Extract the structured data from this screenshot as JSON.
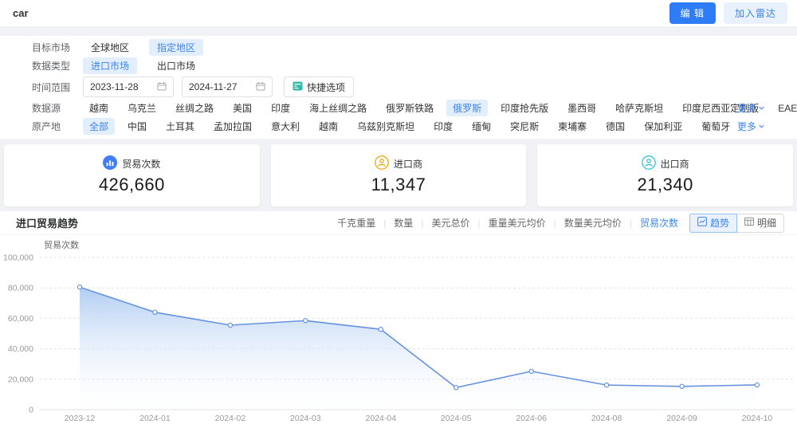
{
  "header": {
    "title": "car",
    "edit_button": "编 辑",
    "radar_button": "加入雷达"
  },
  "filters": {
    "target_market": {
      "label": "目标市场",
      "options": [
        {
          "label": "全球地区",
          "selected": false
        },
        {
          "label": "指定地区",
          "selected": true
        }
      ]
    },
    "data_type": {
      "label": "数据类型",
      "options": [
        {
          "label": "进口市场",
          "selected": true
        },
        {
          "label": "出口市场",
          "selected": false
        }
      ]
    },
    "time_range": {
      "label": "时间范围",
      "start": "2023-11-28",
      "end": "2024-11-27",
      "quick_button": "快捷选项"
    },
    "data_source": {
      "label": "数据源",
      "more": "更多",
      "options": [
        {
          "label": "越南",
          "selected": false
        },
        {
          "label": "乌克兰",
          "selected": false
        },
        {
          "label": "丝绸之路",
          "selected": false
        },
        {
          "label": "美国",
          "selected": false
        },
        {
          "label": "印度",
          "selected": false
        },
        {
          "label": "海上丝绸之路",
          "selected": false
        },
        {
          "label": "俄罗斯铁路",
          "selected": false
        },
        {
          "label": "俄罗斯",
          "selected": true
        },
        {
          "label": "印度抢先版",
          "selected": false
        },
        {
          "label": "墨西哥",
          "selected": false
        },
        {
          "label": "哈萨克斯坦",
          "selected": false
        },
        {
          "label": "印度尼西亚定制版",
          "selected": false
        },
        {
          "label": "EAEU(哈萨克斯坦)",
          "selected": false
        }
      ]
    },
    "origin": {
      "label": "原产地",
      "more": "更多",
      "options": [
        {
          "label": "全部",
          "selected": true
        },
        {
          "label": "中国",
          "selected": false
        },
        {
          "label": "土耳其",
          "selected": false
        },
        {
          "label": "孟加拉国",
          "selected": false
        },
        {
          "label": "意大利",
          "selected": false
        },
        {
          "label": "越南",
          "selected": false
        },
        {
          "label": "乌兹别克斯坦",
          "selected": false
        },
        {
          "label": "印度",
          "selected": false
        },
        {
          "label": "缅甸",
          "selected": false
        },
        {
          "label": "突尼斯",
          "selected": false
        },
        {
          "label": "柬埔寨",
          "selected": false
        },
        {
          "label": "德国",
          "selected": false
        },
        {
          "label": "保加利亚",
          "selected": false
        },
        {
          "label": "葡萄牙",
          "selected": false
        }
      ]
    }
  },
  "stats": [
    {
      "label": "贸易次数",
      "value": "426,660",
      "icon": "bar-chart-icon",
      "color": "#3f7ef7"
    },
    {
      "label": "进口商",
      "value": "11,347",
      "icon": "importer-icon",
      "color": "#f0a818"
    },
    {
      "label": "出口商",
      "value": "21,340",
      "icon": "exporter-icon",
      "color": "#35c3d9"
    }
  ],
  "chart_section": {
    "title": "进口贸易趋势",
    "metrics": [
      {
        "label": "千克重量",
        "selected": false
      },
      {
        "label": "数量",
        "selected": false
      },
      {
        "label": "美元总价",
        "selected": false
      },
      {
        "label": "重量美元均价",
        "selected": false
      },
      {
        "label": "数量美元均价",
        "selected": false
      },
      {
        "label": "贸易次数",
        "selected": true
      }
    ],
    "view_buttons": [
      {
        "label": "趋势",
        "selected": true,
        "icon": "trend-icon"
      },
      {
        "label": "明细",
        "selected": false,
        "icon": "detail-icon"
      }
    ]
  },
  "chart_data": {
    "type": "area",
    "title": "进口贸易趋势",
    "x": [
      "2023-12",
      "2024-01",
      "2024-02",
      "2024-03",
      "2024-04",
      "2024-05",
      "2024-06",
      "2024-08",
      "2024-09",
      "2024-10"
    ],
    "series": [
      {
        "name": "贸易次数",
        "values": [
          80500,
          64000,
          55500,
          58500,
          52800,
          14500,
          25200,
          16200,
          15300,
          16300
        ]
      }
    ],
    "xlabel": "",
    "ylabel": "贸易次数",
    "ylim": [
      0,
      100000
    ],
    "ytick_values": [
      0,
      20000,
      40000,
      60000,
      80000,
      100000
    ],
    "grid": true,
    "legend": "none",
    "line_color": "#6693e1",
    "area_color": "#aecbf2"
  }
}
